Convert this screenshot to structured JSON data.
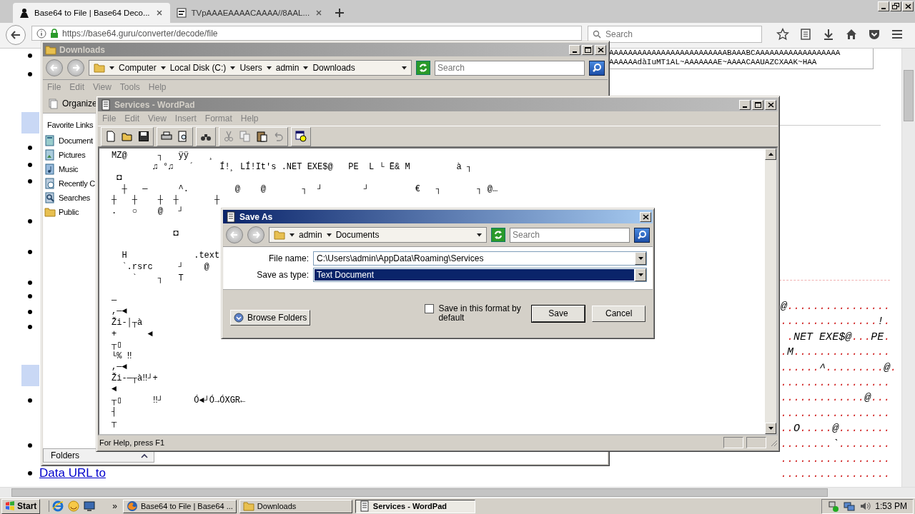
{
  "browser": {
    "tabs": [
      {
        "label": "Base64 to File | Base64 Deco...",
        "selected": true
      },
      {
        "label": "TVpAAAEAAAACAAAA//8AAL...",
        "selected": false
      }
    ],
    "url": "https://base64.guru/converter/decode/file",
    "search": {
      "placeholder": "Search"
    },
    "page": {
      "link": "Data URL to",
      "textarea_lines": [
        "AAAAAAAAAAAAAAAAAAAAAAAAABAAABCAAAAAAAAAAAAAAAAAA",
        "AAAAAAdàIuMT1AL~AAAAAAAE~AAAACAAUAZCXAAK~HAA"
      ],
      "hex_rows": [
        "@................",
        "...............!.",
        " .NET EXE$@...PE.",
        ".M...............",
        "......^.........@.",
        ".................",
        ".............@...",
        ".................",
        "..O.....@........",
        "........`........",
        ".................",
        "................."
      ]
    }
  },
  "downloads": {
    "title": "Downloads",
    "breadcrumb": [
      "Computer",
      "Local Disk (C:)",
      "Users",
      "admin",
      "Downloads"
    ],
    "search": {
      "placeholder": "Search"
    },
    "menu": [
      "File",
      "Edit",
      "View",
      "Tools",
      "Help"
    ],
    "organize": "Organize",
    "favorites_title": "Favorite Links",
    "favorites": [
      {
        "label": "Document",
        "kind": "documents"
      },
      {
        "label": "Pictures",
        "kind": "pictures"
      },
      {
        "label": "Music",
        "kind": "music"
      },
      {
        "label": "Recently C",
        "kind": "recent"
      },
      {
        "label": "Searches",
        "kind": "searches"
      },
      {
        "label": "Public",
        "kind": "public"
      }
    ],
    "folders": "Folders"
  },
  "wordpad": {
    "title": "Services - WordPad",
    "menu": [
      "File",
      "Edit",
      "View",
      "Insert",
      "Format",
      "Help"
    ],
    "lines": [
      {
        "kind": "text",
        "text": "MZ@      ┐   ÿÿ    ¸"
      },
      {
        "kind": "text",
        "text": "        ♫ °♫   ´     Í!¸ LÍ!It's .NET EXE$@   PE  L └ Ë& M         à ┐"
      },
      {
        "kind": "text",
        "text": " ◘"
      },
      {
        "kind": "text",
        "text": "  ┼   ─      ^.         @    @       ┐  ┘        ┘         €   ┐       ┐ @…"
      },
      {
        "kind": "text",
        "text": "┼   ┼    ┼  ┼       ┼"
      },
      {
        "kind": "text",
        "text": ".   ○    @   ┘"
      },
      {
        "kind": "blank"
      },
      {
        "kind": "text",
        "text": "            ◘"
      },
      {
        "kind": "blank"
      },
      {
        "kind": "text",
        "text": "  H             .text"
      },
      {
        "kind": "text",
        "text": "  `.rsrc     ┘    @"
      },
      {
        "kind": "text",
        "text": "    `    ┐   T"
      },
      {
        "kind": "blank"
      },
      {
        "kind": "text",
        "text": "─"
      },
      {
        "kind": "text",
        "text": ",─◄"
      },
      {
        "kind": "text",
        "text": "Ži-│┬à"
      },
      {
        "kind": "text",
        "text": "+      ◄"
      },
      {
        "kind": "text",
        "text": "┬▯"
      },
      {
        "kind": "text",
        "text": "└% ‼"
      },
      {
        "kind": "text",
        "text": ",─◄"
      },
      {
        "kind": "text",
        "text": "Ži-─┬à‼┘+"
      },
      {
        "kind": "text",
        "text": "◄"
      },
      {
        "kind": "text",
        "text": "┬▯      ‼┘      Ó◄┘Ó→ÓXGR←"
      },
      {
        "kind": "text",
        "text": "┤"
      },
      {
        "kind": "text",
        "text": "┬"
      }
    ],
    "status": "For Help, press F1"
  },
  "save_as": {
    "title": "Save As",
    "breadcrumb": [
      "admin",
      "Documents"
    ],
    "search": {
      "placeholder": "Search"
    },
    "fields": [
      {
        "label": "File name:",
        "value": "C:\\Users\\admin\\AppData\\Roaming\\Services",
        "selected": false
      },
      {
        "label": "Save as type:",
        "value": "Text Document",
        "selected": true
      }
    ],
    "browse": "Browse Folders",
    "checkbox": {
      "label": "Save in this format by default",
      "checked": false
    },
    "buttons": [
      {
        "label": "Save",
        "default": true
      },
      {
        "label": "Cancel",
        "default": false
      }
    ]
  },
  "taskbar": {
    "start": "Start",
    "chevron": "»",
    "tasks": [
      {
        "label": "Base64 to File | Base64 ...",
        "kind": "browser",
        "selected": false
      },
      {
        "label": "Downloads",
        "kind": "folder",
        "selected": false
      },
      {
        "label": "Services - WordPad",
        "kind": "wordpad",
        "selected": true
      }
    ],
    "clock": "1:53 PM"
  }
}
